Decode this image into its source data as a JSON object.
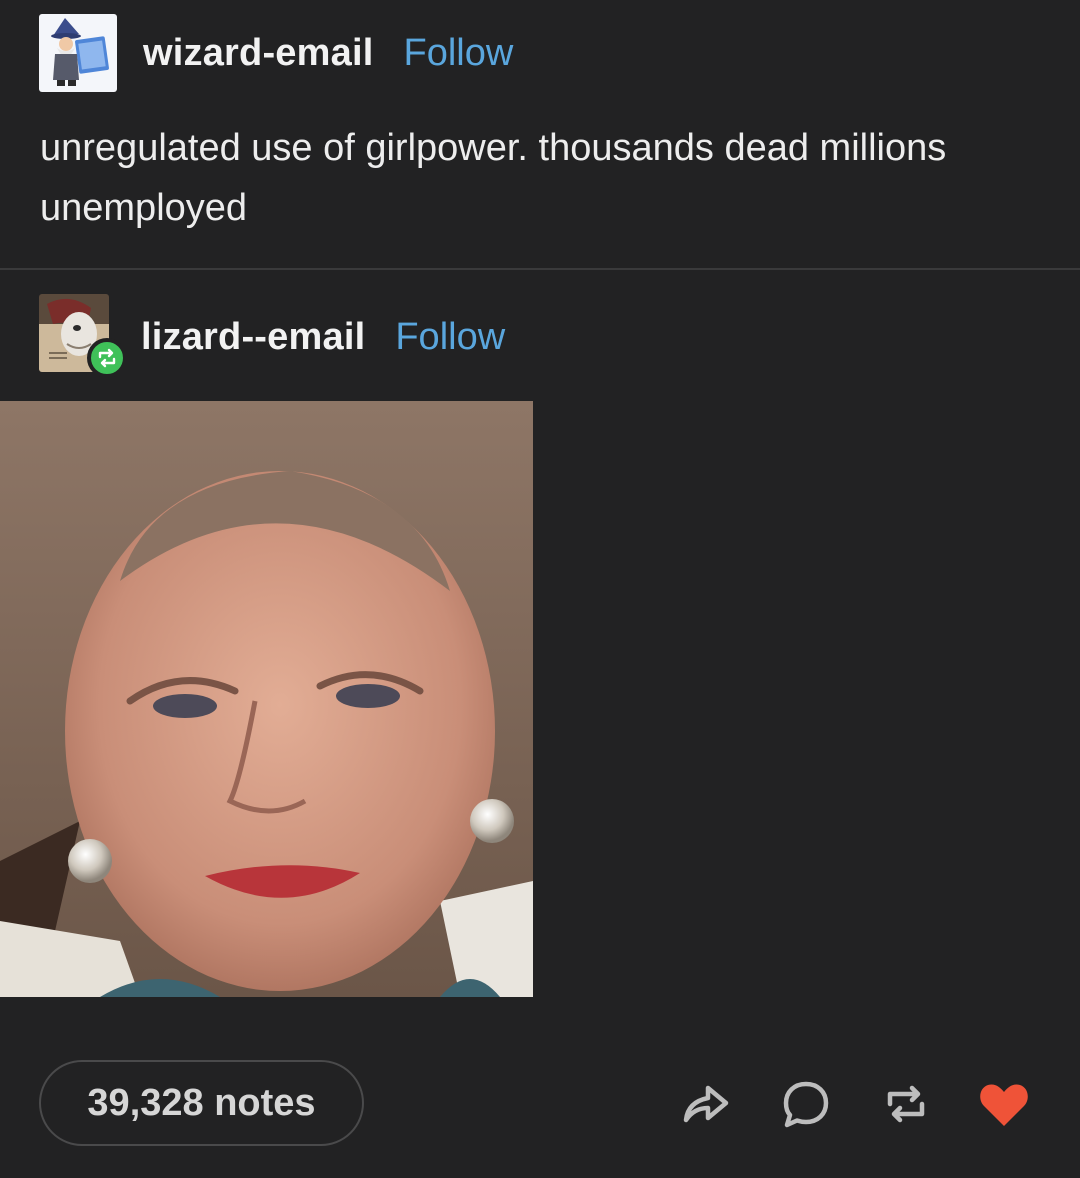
{
  "post": {
    "author": {
      "username": "wizard-email",
      "follow_label": "Follow",
      "avatar_icon": "wizard-avatar"
    },
    "text": "unregulated use of girlpower. thousands dead millions unemployed",
    "reblog": {
      "username": "lizard--email",
      "follow_label": "Follow",
      "avatar_icon": "lizard-avatar",
      "badge_icon": "reblog-badge-icon",
      "badge_color": "#3fc159"
    },
    "image": {
      "subject": "portrait-photo"
    }
  },
  "footer": {
    "notes_label": "39,328 notes",
    "actions": [
      {
        "name": "share-icon"
      },
      {
        "name": "reply-icon"
      },
      {
        "name": "reblog-icon"
      },
      {
        "name": "like-icon",
        "color": "#ef5338"
      }
    ]
  },
  "colors": {
    "background": "#222223",
    "link": "#5aa6dd",
    "text": "#ededed"
  }
}
